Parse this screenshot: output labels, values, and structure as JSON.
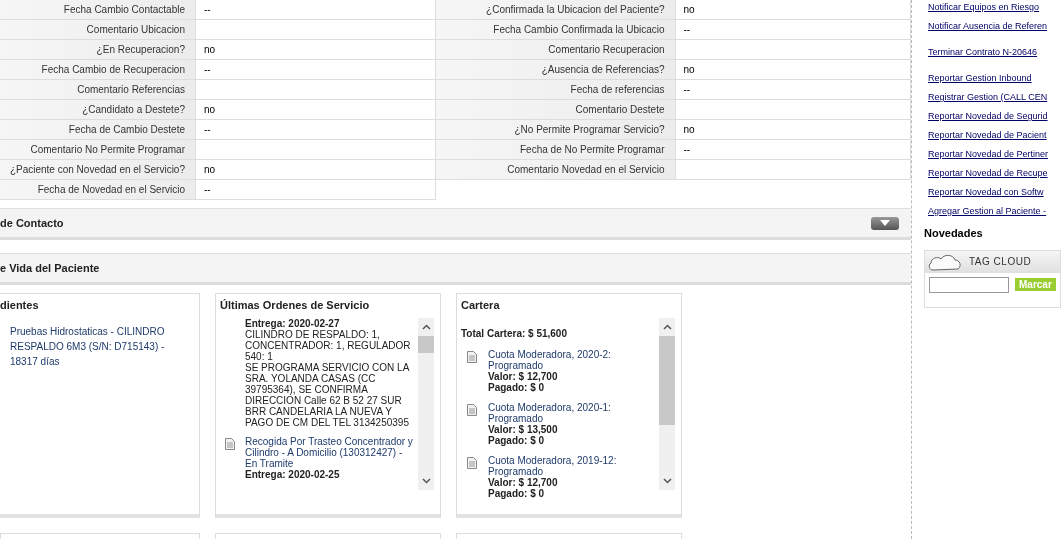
{
  "details": {
    "left": [
      {
        "label": "Fecha Cambio Contactable",
        "value": "--"
      },
      {
        "label": "Comentario Ubicacion"
      },
      {
        "label": "¿En Recuperacion?",
        "value": "no"
      },
      {
        "label": "Fecha Cambio de Recuperacion",
        "value": "--"
      },
      {
        "label": "Comentario Referencias"
      },
      {
        "label": "¿Candidato a Destete?",
        "value": "no"
      },
      {
        "label": "Fecha de Cambio Destete",
        "value": "--"
      },
      {
        "label": "Comentario No Permite Programar"
      },
      {
        "label": "¿Paciente con Novedad en el Servicio?",
        "value": "no"
      },
      {
        "label": "Fecha de Novedad en el Servicio",
        "value": "--"
      }
    ],
    "right": [
      {
        "label": "¿Confirmada la Ubicacion del Paciente?",
        "value": "no"
      },
      {
        "label": "Fecha Cambio Confirmada la Ubicacio",
        "value": "--"
      },
      {
        "label": "Comentario Recuperacion"
      },
      {
        "label": "¿Ausencia de Referencias?",
        "value": "no"
      },
      {
        "label": "Fecha de referencias",
        "value": "--"
      },
      {
        "label": "Comentario Destete"
      },
      {
        "label": "¿No Permite Programar Servicio?",
        "value": "no"
      },
      {
        "label": "Fecha de No Permite Programar",
        "value": "--"
      },
      {
        "label": "Comentario Novedad en el Servicio"
      }
    ]
  },
  "sections": [
    {
      "title": "de Contacto",
      "collapsed": true
    },
    {
      "title": "e Vida del Paciente",
      "collapsed": false
    }
  ],
  "cards": [
    {
      "kind": "list",
      "title": "dientes",
      "items": [
        {
          "text": "Pruebas Hidrostaticas - CILINDRO RESPALDO 6M3 (S/N: D715143) - 18317 días"
        }
      ]
    },
    {
      "kind": "orders",
      "title": "Últimas Ordenes de Servicio",
      "items": [
        {
          "delivery": "Entrega: 2020-02-27",
          "notes": [
            "CILINDRO DE RESPALDO: 1, CONCENTRADOR: 1, REGULADOR 540: 1",
            "SE PROGRAMA SERVICIO CON LA SRA. YOLANDA CASAS (CC 39795364), SE CONFIRMA DIRECCION Calle 62 B 52 27 SUR BRR CANDELARIA LA NUEVA Y PAGO DE CM DEL TEL 3134250395"
          ]
        },
        {
          "title": "Recogida Por Trasteo Concentrador y Cilindro - A Domicilio (130312427) - En Tramite",
          "delivery": "Entrega: 2020-02-25"
        }
      ]
    },
    {
      "kind": "cartera",
      "title": "Cartera",
      "total": "Total Cartera: $ 51,600",
      "items": [
        {
          "title": "Cuota Moderadora, 2020-2: Programado",
          "value": "Valor: $ 12,700",
          "paid": "Pagado: $ 0"
        },
        {
          "title": "Cuota Moderadora, 2020-1: Programado",
          "value": "Valor: $ 13,500",
          "paid": "Pagado: $ 0"
        },
        {
          "title": "Cuota Moderadora, 2019-12: Programado",
          "value": "Valor: $ 12,700",
          "paid": "Pagado: $ 0"
        }
      ]
    }
  ],
  "sidebar": {
    "link_groups": [
      {
        "links": [
          "Notificar Equipos en Riesgo",
          "Notificar Ausencia de Referen"
        ]
      },
      {
        "links": [
          "Terminar Contrato N-20646"
        ]
      },
      {
        "links": [
          "Reportar Gestion Inbound",
          "Registrar Gestion (CALL CEN",
          "Reportar Novedad de Segurid",
          "Reportar Novedad de Pacient",
          "Reportar Novedad de Pertiner",
          "Reportar Novedad de Recupe",
          "Reportar Novedad con Softw",
          "Agregar Gestion al Paciente -"
        ]
      }
    ],
    "heading": "Novedades",
    "tag_cloud": {
      "title": "TAG CLOUD",
      "button": "Marcar"
    }
  }
}
